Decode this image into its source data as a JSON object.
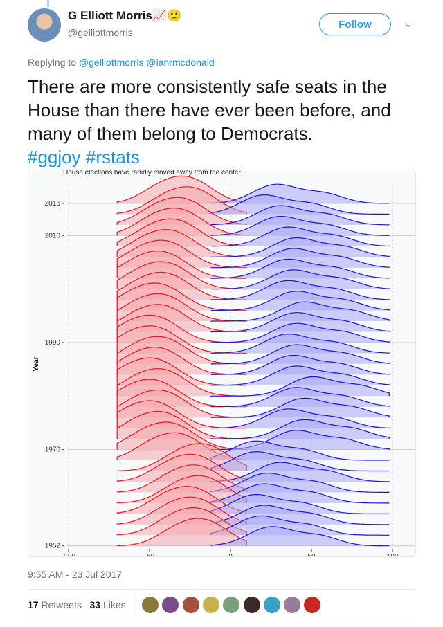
{
  "tweet": {
    "author_name": "G Elliott Morris",
    "author_emoji": "📈🙂",
    "handle": "@gelliottmorris",
    "follow_label": "Follow",
    "replying_prefix": "Replying to",
    "replying_to": [
      "@gelliottmorris",
      "@ianrmcdonald"
    ],
    "text": "There are more consistently safe seats in the House than there have ever been before, and many of them belong to Democrats.",
    "hashtags": [
      "#ggjoy",
      "#rstats"
    ],
    "timestamp": "9:55 AM - 23 Jul 2017",
    "retweets": "17",
    "retweets_label": "Retweets",
    "likes": "33",
    "likes_label": "Likes",
    "liker_avatar_colors": [
      "#8a7a3a",
      "#7a4a8a",
      "#a0523a",
      "#c8b04a",
      "#7aa07a",
      "#3a2a2a",
      "#3aa0c8",
      "#9a7a9a",
      "#c8281e"
    ]
  },
  "chart_data": {
    "type": "ridgeline",
    "title": "House elections have rapidly moved away from the center",
    "ylabel": "Year",
    "xlim": [
      -100,
      100
    ],
    "xticks": [
      "-100",
      "-50",
      "0",
      "50",
      "100"
    ],
    "ytick_labels": [
      "2016",
      "2010",
      "1990",
      "1970",
      "1952"
    ],
    "ylim": [
      1952,
      2016
    ],
    "grid": true,
    "years": [
      1952,
      1954,
      1956,
      1958,
      1960,
      1962,
      1964,
      1966,
      1968,
      1970,
      1972,
      1974,
      1976,
      1978,
      1980,
      1982,
      1984,
      1986,
      1988,
      1990,
      1992,
      1994,
      1996,
      1998,
      2000,
      2002,
      2004,
      2006,
      2008,
      2010,
      2012,
      2014,
      2016
    ],
    "series": [
      {
        "party": "Republican",
        "color": "#e8141c",
        "fill": "#f4a8ad",
        "modes": [
          -15,
          -18,
          -20,
          -22,
          -15,
          -18,
          -20,
          -14,
          -30,
          -35,
          -40,
          -45,
          -40,
          -45,
          -40,
          -45,
          -42,
          -40,
          -45,
          -45,
          -40,
          -40,
          -42,
          -38,
          -38,
          -40,
          -38,
          -35,
          -32,
          -30,
          -28,
          -22,
          -25
        ]
      },
      {
        "party": "Democratic",
        "color": "#1e14d8",
        "fill": "#a8a8f4",
        "modes": [
          25,
          18,
          20,
          15,
          20,
          22,
          30,
          15,
          15,
          40,
          45,
          35,
          45,
          40,
          50,
          40,
          38,
          40,
          35,
          40,
          40,
          45,
          40,
          35,
          38,
          35,
          38,
          40,
          35,
          30,
          30,
          20,
          28
        ]
      }
    ]
  }
}
